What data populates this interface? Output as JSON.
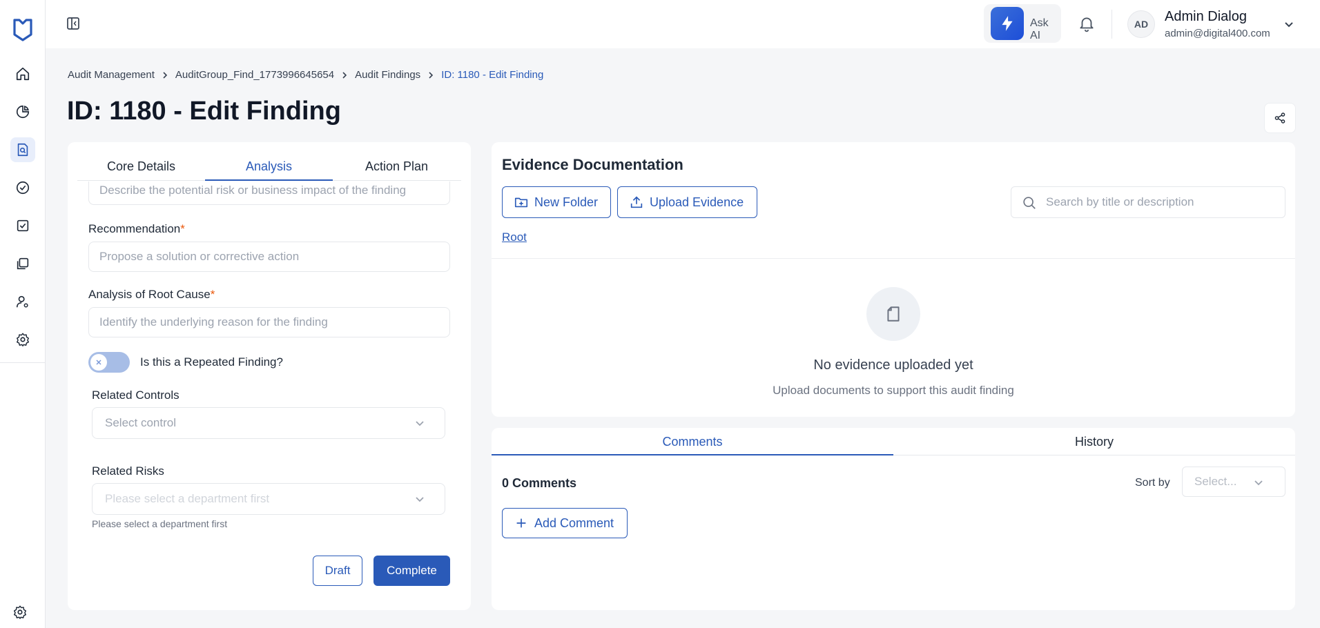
{
  "header": {
    "ask_ai_label": "Ask AI",
    "avatar_initials": "AD",
    "user_name": "Admin Dialog",
    "user_email": "admin@digital400.com"
  },
  "breadcrumb": [
    "Audit Management",
    "AuditGroup_Find_1773996645654",
    "Audit Findings",
    "ID: 1180 - Edit Finding"
  ],
  "page_title": "ID: 1180 - Edit Finding",
  "tabs": [
    "Core Details",
    "Analysis",
    "Action Plan"
  ],
  "active_tab": "Analysis",
  "form": {
    "impact_placeholder": "Describe the potential risk or business impact of the finding",
    "recommendation_label": "Recommendation",
    "recommendation_placeholder": "Propose a solution or corrective action",
    "root_cause_label": "Analysis of Root Cause",
    "root_cause_placeholder": "Identify the underlying reason for the finding",
    "required_mark": "*",
    "repeated_label": "Is this a Repeated Finding?",
    "repeated_value": false,
    "controls_label": "Related Controls",
    "controls_placeholder": "Select control",
    "risks_label": "Related Risks",
    "risks_placeholder": "Please select a department first",
    "risks_helper": "Please select a department first",
    "draft_label": "Draft",
    "complete_label": "Complete"
  },
  "evidence": {
    "title": "Evidence Documentation",
    "new_folder_label": "New Folder",
    "upload_label": "Upload Evidence",
    "search_placeholder": "Search by title or description",
    "root_link": "Root",
    "empty_title": "No evidence uploaded yet",
    "empty_subtitle": "Upload documents to support this audit finding"
  },
  "comments": {
    "tabs": [
      "Comments",
      "History"
    ],
    "active_tab": "Comments",
    "count_label": "0 Comments",
    "sort_label": "Sort by",
    "sort_placeholder": "Select...",
    "add_label": "Add Comment"
  },
  "colors": {
    "accent": "#2a5ab8",
    "required": "#ea580c"
  }
}
